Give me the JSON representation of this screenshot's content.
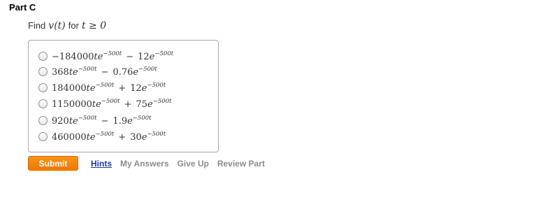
{
  "part": {
    "title": "Part C"
  },
  "prompt": {
    "lead": "Find",
    "func": "v(t)",
    "mid": "for",
    "condition": "t ≥ 0"
  },
  "choices": [
    {
      "c1": "−184000",
      "v1": "te",
      "e1": "−500t",
      "op": "−",
      "c2": "12",
      "v2": "e",
      "e2": "−500t"
    },
    {
      "c1": "368",
      "v1": "te",
      "e1": "−500t",
      "op": "−",
      "c2": "0.76",
      "v2": "e",
      "e2": "−500t"
    },
    {
      "c1": "184000",
      "v1": "te",
      "e1": "−500t",
      "op": "+",
      "c2": "12",
      "v2": "e",
      "e2": "−500t"
    },
    {
      "c1": "1150000",
      "v1": "te",
      "e1": "−500t",
      "op": "+",
      "c2": "75",
      "v2": "e",
      "e2": "−500t"
    },
    {
      "c1": "920",
      "v1": "te",
      "e1": "−500t",
      "op": "−",
      "c2": "1.9",
      "v2": "e",
      "e2": "−500t"
    },
    {
      "c1": "460000",
      "v1": "te",
      "e1": "−500t",
      "op": "+",
      "c2": "30",
      "v2": "e",
      "e2": "−500t"
    }
  ],
  "actions": {
    "submit": "Submit",
    "hints": "Hints",
    "my_answers": "My Answers",
    "give_up": "Give Up",
    "review_part": "Review Part"
  }
}
